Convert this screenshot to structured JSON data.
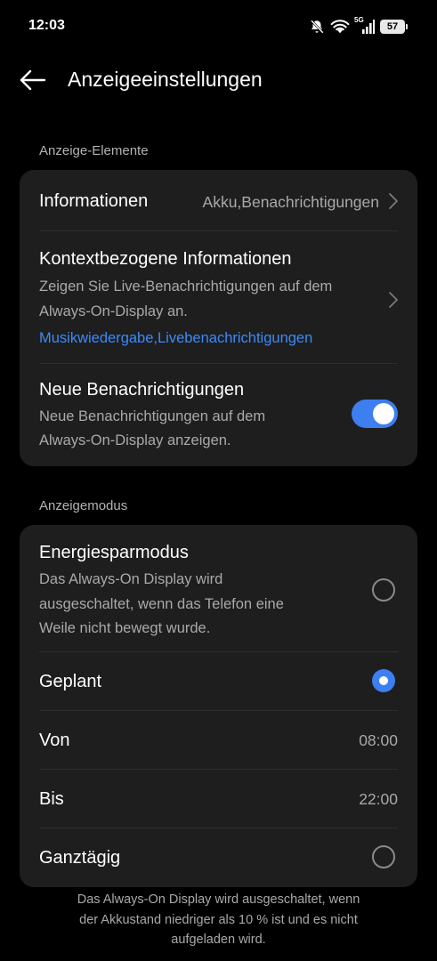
{
  "status_bar": {
    "time": "12:03",
    "network": "5G",
    "battery_level": "57"
  },
  "header": {
    "title": "Anzeigeeinstellungen"
  },
  "section_display_elements": {
    "label": "Anzeige-Elemente",
    "informationen": {
      "title": "Informationen",
      "value": "Akku,Benachrichtigungen"
    },
    "context_info": {
      "title": "Kontextbezogene Informationen",
      "subtitle_line1": "Zeigen Sie Live-Benachrichtigungen auf dem",
      "subtitle_line2": "Always-On-Display an.",
      "link": "Musikwiedergabe,Livebenachrichtigungen"
    },
    "new_notifications": {
      "title": "Neue Benachrichtigungen",
      "subtitle_line1": "Neue Benachrichtigungen auf dem",
      "subtitle_line2": "Always-On-Display anzeigen.",
      "enabled": true
    }
  },
  "section_display_mode": {
    "label": "Anzeigemodus",
    "energy_saving": {
      "title": "Energiesparmodus",
      "subtitle_line1": "Das Always-On Display wird",
      "subtitle_line2": "ausgeschaltet, wenn das Telefon eine",
      "subtitle_line3": "Weile nicht bewegt wurde.",
      "selected": false
    },
    "scheduled": {
      "title": "Geplant",
      "selected": true
    },
    "from": {
      "title": "Von",
      "value": "08:00"
    },
    "to": {
      "title": "Bis",
      "value": "22:00"
    },
    "all_day": {
      "title": "Ganztägig",
      "selected": false
    }
  },
  "footer": {
    "line1": "Das Always-On Display wird ausgeschaltet, wenn",
    "line2": "der Akkustand niedriger als 10 % ist und es nicht",
    "line3": "aufgeladen wird."
  },
  "colors": {
    "accent": "#3d7ef0",
    "link": "#3d8af7",
    "card": "#1e1e1e",
    "background": "#000000"
  }
}
